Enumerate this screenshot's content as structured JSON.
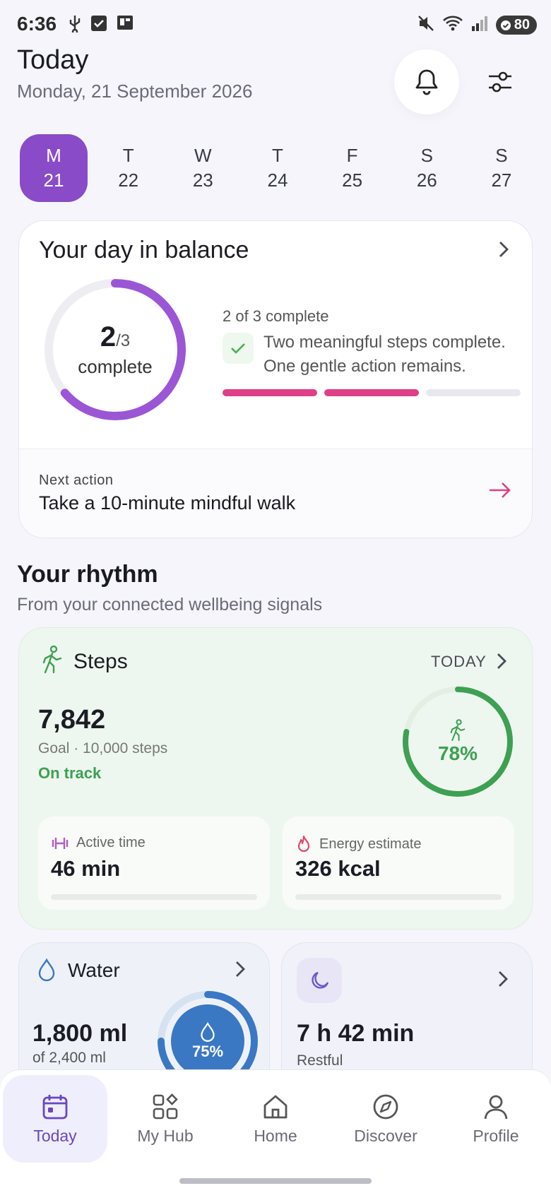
{
  "status_bar": {
    "time": "6:36",
    "battery": "80",
    "left_icons": [
      "usb-icon",
      "check-icon",
      "sim-icon"
    ],
    "right_icons": [
      "mute-icon",
      "wifi-icon",
      "signal-icon",
      "battery-icon"
    ]
  },
  "header": {
    "title": "Today",
    "date": "Monday, 21 September 2026"
  },
  "week": {
    "days": [
      {
        "letter": "M",
        "num": "21",
        "selected": true
      },
      {
        "letter": "T",
        "num": "22"
      },
      {
        "letter": "W",
        "num": "23"
      },
      {
        "letter": "T",
        "num": "24"
      },
      {
        "letter": "F",
        "num": "25"
      },
      {
        "letter": "S",
        "num": "26"
      },
      {
        "letter": "S",
        "num": "27"
      }
    ]
  },
  "balance": {
    "title": "Your day in balance",
    "done": "2",
    "total": "/3",
    "ring_label": "complete",
    "progress_text": "2 of 3 complete",
    "message_line1": "Two meaningful steps complete.",
    "message_line2": "One gentle action remains.",
    "fraction": 0.67,
    "accent": "#9b56d6",
    "bar_color": "#de3f86"
  },
  "next_action": {
    "label": "Next action",
    "text": "Take a 10-minute mindful walk"
  },
  "rhythm": {
    "title": "Your rhythm",
    "subtitle": "From your connected wellbeing signals"
  },
  "steps": {
    "title": "Steps",
    "period": "TODAY",
    "value": "7,842",
    "goal": "Goal · 10,000 steps",
    "status": "On track",
    "percent": "78%",
    "fraction": 0.78,
    "accent": "#3da052",
    "active_time": {
      "label": "Active time",
      "value": "46 min"
    },
    "energy": {
      "label": "Energy estimate",
      "value": "326 kcal"
    }
  },
  "water": {
    "title": "Water",
    "value": "1,800 ml",
    "goal": "of 2,400 ml",
    "percent": "75%",
    "fraction": 0.75,
    "accent": "#3a78c4"
  },
  "sleep": {
    "value": "7 h 42 min",
    "status": "Restful"
  },
  "nav": {
    "items": [
      {
        "label": "Today",
        "icon": "calendar-icon",
        "active": true
      },
      {
        "label": "My Hub",
        "icon": "grid-icon"
      },
      {
        "label": "Home",
        "icon": "home-icon"
      },
      {
        "label": "Discover",
        "icon": "compass-icon"
      },
      {
        "label": "Profile",
        "icon": "person-icon"
      }
    ]
  }
}
